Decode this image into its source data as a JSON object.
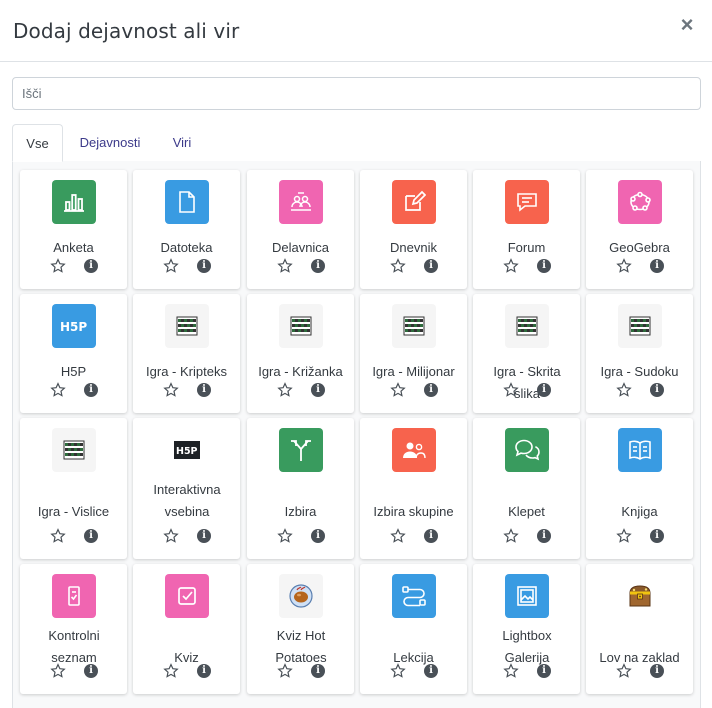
{
  "modal": {
    "title": "Dodaj dejavnost ali vir",
    "close_glyph": "×"
  },
  "search": {
    "placeholder": "Išči"
  },
  "tabs": [
    {
      "label": "Vse",
      "active": true
    },
    {
      "label": "Dejavnosti",
      "active": false
    },
    {
      "label": "Viri",
      "active": false
    }
  ],
  "items": [
    {
      "label": "Anketa",
      "icon": "feedback-chart-icon",
      "color": "#399b5e"
    },
    {
      "label": "Datoteka",
      "icon": "file-icon",
      "color": "#399be2"
    },
    {
      "label": "Delavnica",
      "icon": "workshop-icon",
      "color": "#f065b1"
    },
    {
      "label": "Dnevnik",
      "icon": "journal-edit-icon",
      "color": "#f7634d"
    },
    {
      "label": "Forum",
      "icon": "forum-icon",
      "color": "#f7634d"
    },
    {
      "label": "GeoGebra",
      "icon": "geogebra-icon",
      "color": "#f065b1"
    },
    {
      "label": "H5P",
      "icon": "h5p-icon",
      "color": "#399be2"
    },
    {
      "label": "Igra - Kripteks",
      "icon": "game-board-icon",
      "color": "#f5f5f5"
    },
    {
      "label": "Igra - Križanka",
      "icon": "game-board-icon",
      "color": "#f5f5f5"
    },
    {
      "label": "Igra - Milijonar",
      "icon": "game-board-icon",
      "color": "#f5f5f5"
    },
    {
      "label": "Igra - Skrita slika",
      "icon": "game-board-icon",
      "color": "#f5f5f5"
    },
    {
      "label": "Igra - Sudoku",
      "icon": "game-board-icon",
      "color": "#f5f5f5"
    },
    {
      "label": "Igra - Vislice",
      "icon": "game-board-icon",
      "color": "#f5f5f5"
    },
    {
      "label": "Interaktivna vsebina",
      "icon": "h5p-dark-icon",
      "color": "#ffffff"
    },
    {
      "label": "Izbira",
      "icon": "choice-icon",
      "color": "#399b5e"
    },
    {
      "label": "Izbira skupine",
      "icon": "group-choice-icon",
      "color": "#f7634d"
    },
    {
      "label": "Klepet",
      "icon": "chat-icon",
      "color": "#399b5e"
    },
    {
      "label": "Knjiga",
      "icon": "book-icon",
      "color": "#399be2"
    },
    {
      "label": "Kontrolni seznam",
      "icon": "checklist-icon",
      "color": "#f065b1"
    },
    {
      "label": "Kviz",
      "icon": "quiz-icon",
      "color": "#f065b1"
    },
    {
      "label": "Kviz Hot Potatoes",
      "icon": "hot-potatoes-icon",
      "color": "#f5f5f5"
    },
    {
      "label": "Lekcija",
      "icon": "lesson-icon",
      "color": "#399be2"
    },
    {
      "label": "Lightbox Galerija",
      "icon": "gallery-icon",
      "color": "#399be2"
    },
    {
      "label": "Lov na zaklad",
      "icon": "treasure-chest-icon",
      "color": "#ffffff"
    }
  ]
}
